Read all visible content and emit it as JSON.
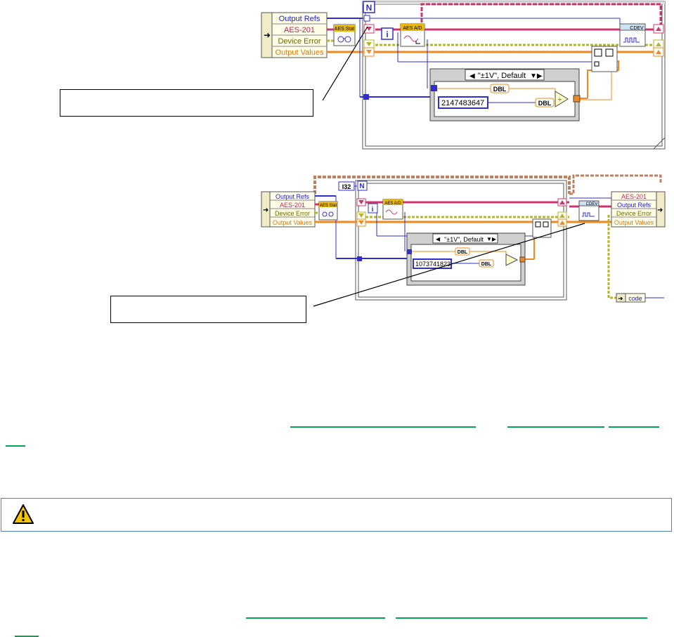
{
  "diagram1": {
    "cluster_items": [
      "Output Refs",
      "AES-201",
      "Device Error",
      "Output Values"
    ],
    "loop_count_terminal": "N",
    "aes_stat_label": "AES Stat",
    "aes_ad_label": "AES A/D",
    "iteration_terminal": "i",
    "case_selector": "\"±1V\", Default",
    "dbl_label": "DBL",
    "constant": "2147483647",
    "cdev_label": "CDEV"
  },
  "diagram2": {
    "cluster_items_left": [
      "Output Refs",
      "AES-201",
      "Device Error",
      "Output Values"
    ],
    "cluster_items_right": [
      "AES-201",
      "Output Refs",
      "Device Error",
      "Output Values"
    ],
    "i32_label": "I32",
    "loop_count_terminal": "N",
    "aes_stat_label": "AES Stat",
    "aes_ad_label": "AES A/D",
    "iteration_terminal": "i",
    "case_selector": "\"±1V\", Default",
    "dbl_label": "DBL",
    "constant": "1073741823",
    "cdev_label": "CDEV",
    "code_label": "code"
  },
  "colors": {
    "blue_wire": "#2f2fd0",
    "pink_wire": "#d0346e",
    "orange_wire": "#f08a1e",
    "yellow_wire": "#b5b525",
    "link_green": "#00a651",
    "note_border": "#4f81bd"
  },
  "icons": [
    "warning-icon",
    "glasses-icon",
    "sine-wave-icon",
    "pulse-icon",
    "array-icon"
  ]
}
